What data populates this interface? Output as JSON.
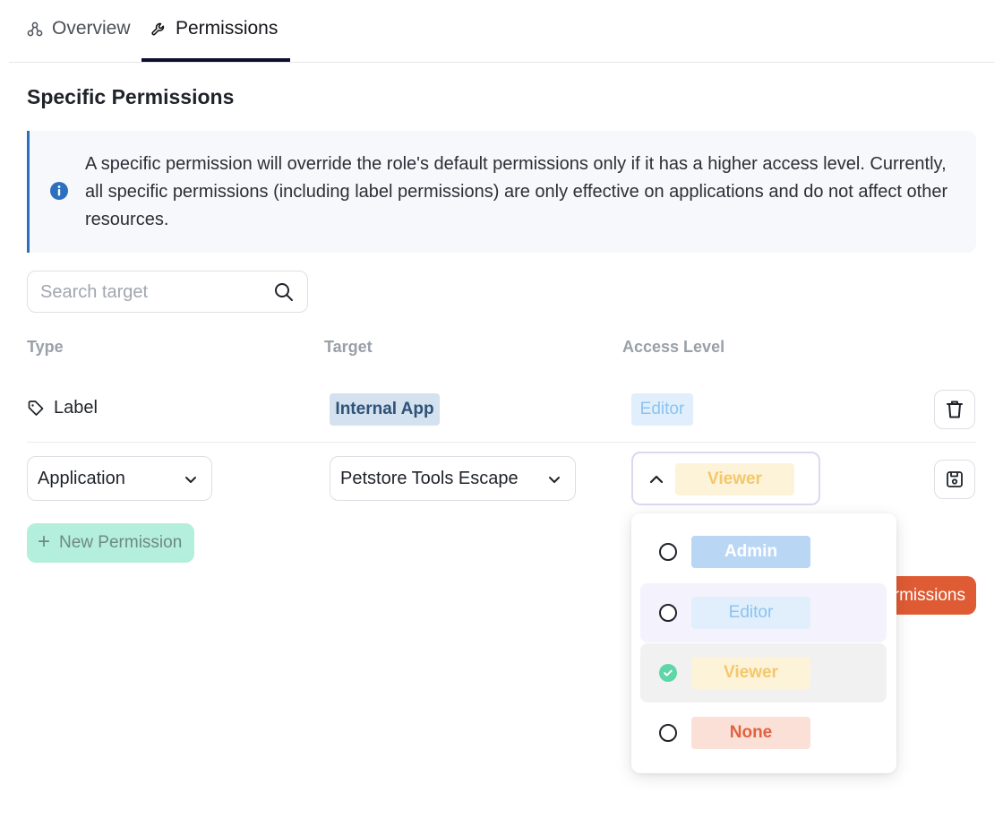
{
  "tabs": {
    "overview": "Overview",
    "permissions": "Permissions",
    "active": "permissions"
  },
  "section": {
    "title": "Specific Permissions"
  },
  "info": {
    "text": "A specific permission will override the role's default permissions only if it has a higher access level. Currently, all specific permissions (including label permissions) are only effective on applications and do not affect other resources."
  },
  "search": {
    "placeholder": "Search target"
  },
  "table": {
    "headers": {
      "type": "Type",
      "target": "Target",
      "access": "Access Level"
    },
    "rows": [
      {
        "type": "Label",
        "target": "Internal App",
        "access": "Editor"
      },
      {
        "type": "Application",
        "target": "Petstore Tools Escape",
        "access": "Viewer"
      }
    ]
  },
  "buttons": {
    "new_permission": "New Permission",
    "save_permissions": "Save Permissions"
  },
  "dropdown": {
    "options": [
      {
        "label": "Admin",
        "checked": false
      },
      {
        "label": "Editor",
        "checked": false
      },
      {
        "label": "Viewer",
        "checked": true
      },
      {
        "label": "None",
        "checked": false
      }
    ]
  },
  "colors": {
    "accent_dark": "#0d0f2e",
    "info_border": "#2d6fbf",
    "new_button_bg": "#b4eedc",
    "save_button_bg": "#df5b34",
    "check_green": "#5fd6a8",
    "admin": "#b9d7f5",
    "editor": "#e1effc",
    "viewer": "#fdf3d9",
    "none": "#fbe0d8"
  },
  "icons": {
    "overview": "nodes-icon",
    "permissions": "wrench-icon",
    "info": "info-circle-icon",
    "search": "search-icon",
    "label": "tag-icon",
    "delete": "trash-icon",
    "save": "floppy-disk-icon",
    "chevron_down": "chevron-down-icon",
    "chevron_up": "chevron-up-icon",
    "plus": "plus-icon"
  }
}
